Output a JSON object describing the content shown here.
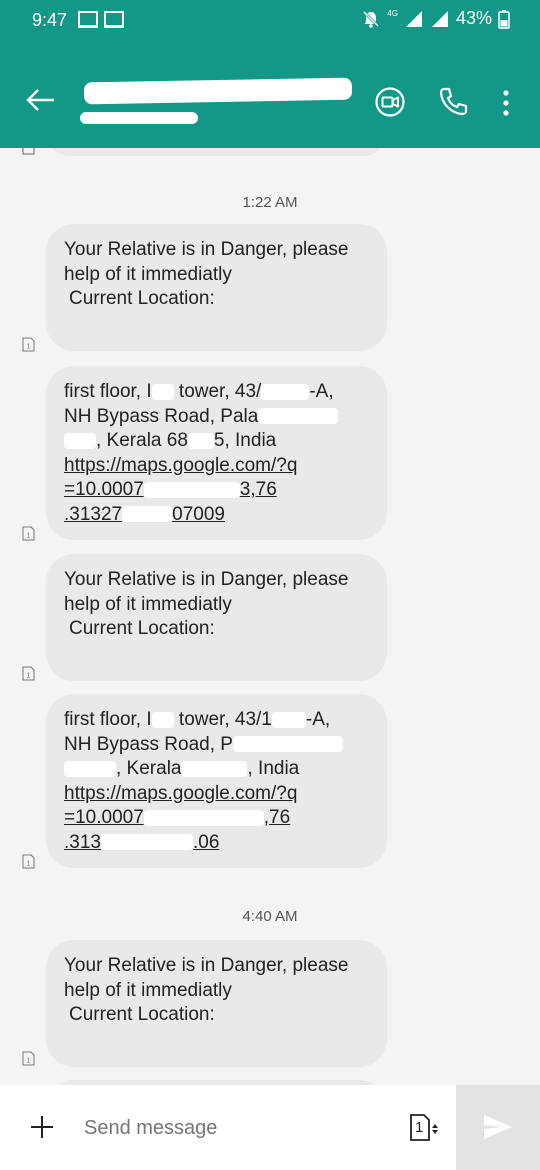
{
  "status_bar": {
    "time": "9:47",
    "network": "4G",
    "battery": "43%",
    "icons": [
      "screen-icon",
      "screen-icon",
      "mute-icon",
      "signal-icon",
      "signal-icon",
      "battery-icon"
    ]
  },
  "app_bar": {
    "contact_name": "",
    "contact_number": "",
    "actions": [
      "back-arrow-icon",
      "video-call-icon",
      "phone-icon",
      "more-vert-icon"
    ]
  },
  "thread": {
    "timestamps": [
      "1:22 AM",
      "4:40 AM"
    ],
    "messages": [
      {
        "lines": [
          "Your Relative is in Danger, please",
          "help of it immediatly",
          " Current Location:"
        ]
      },
      {
        "lines": [
          "first floor, I",
          "tower, 43/",
          "-A,",
          "NH Bypass Road, Pala",
          ", Kerala 68",
          "5, India",
          "https://maps.google.com/?q",
          "=10.0007",
          "3,76",
          ".31327",
          "07009"
        ]
      },
      {
        "lines": [
          "Your Relative is in Danger, please",
          "help of it immediatly",
          " Current Location:"
        ]
      },
      {
        "lines": [
          "first floor, I",
          "tower, 43/1",
          "-A,",
          "NH Bypass Road, P",
          ", Kerala",
          ", India",
          "https://maps.google.com/?q",
          "=10.0007",
          ",76",
          ".313",
          ".06"
        ]
      },
      {
        "lines": [
          "Your Relative is in Danger, please",
          "help of it immediatly",
          " Current Location:"
        ]
      }
    ]
  },
  "composer": {
    "placeholder": "Send message",
    "sim_label": "1"
  },
  "colors": {
    "header": "#139888",
    "bubble": "#e9e9e9",
    "background": "#f4f4f4"
  }
}
